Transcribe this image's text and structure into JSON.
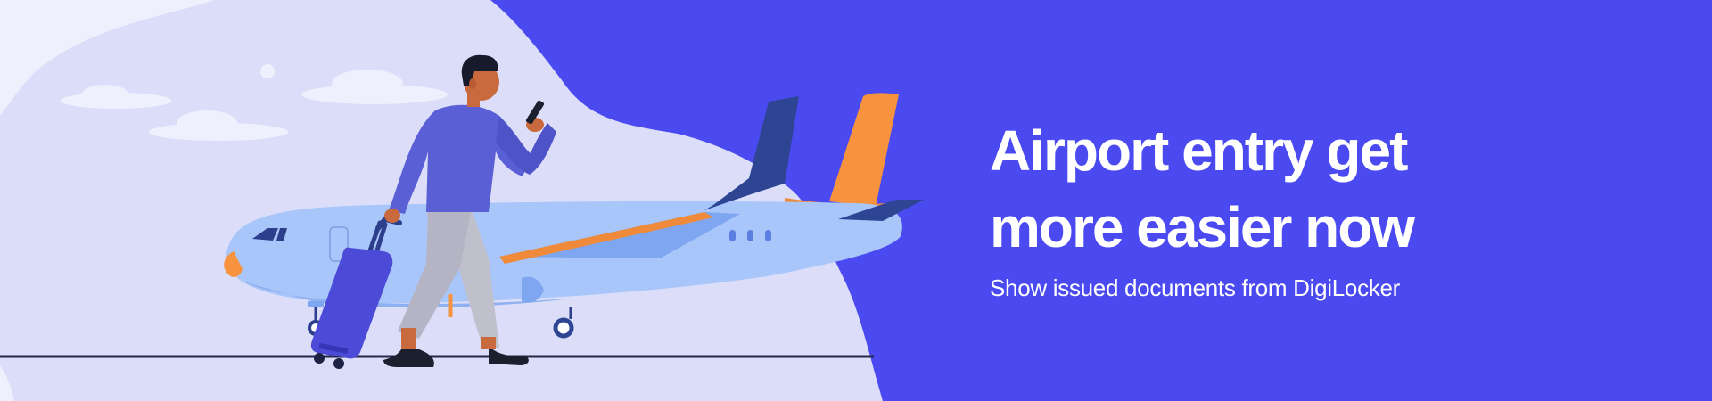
{
  "banner": {
    "headline_line1": "Airport entry get",
    "headline_line2": "more easier now",
    "subtitle": "Show issued documents from DigiLocker"
  },
  "colors": {
    "brand_blue": "#4a4af0",
    "sky": "#dcdef9",
    "plane_body": "#a8c6fa",
    "tail": "#f7923f",
    "shirt": "#5b5fd6",
    "suitcase": "#4b4bd8",
    "skin": "#c9693e"
  },
  "icons": [
    "airplane-illustration",
    "traveler-illustration",
    "suitcase-illustration",
    "phone-icon"
  ]
}
